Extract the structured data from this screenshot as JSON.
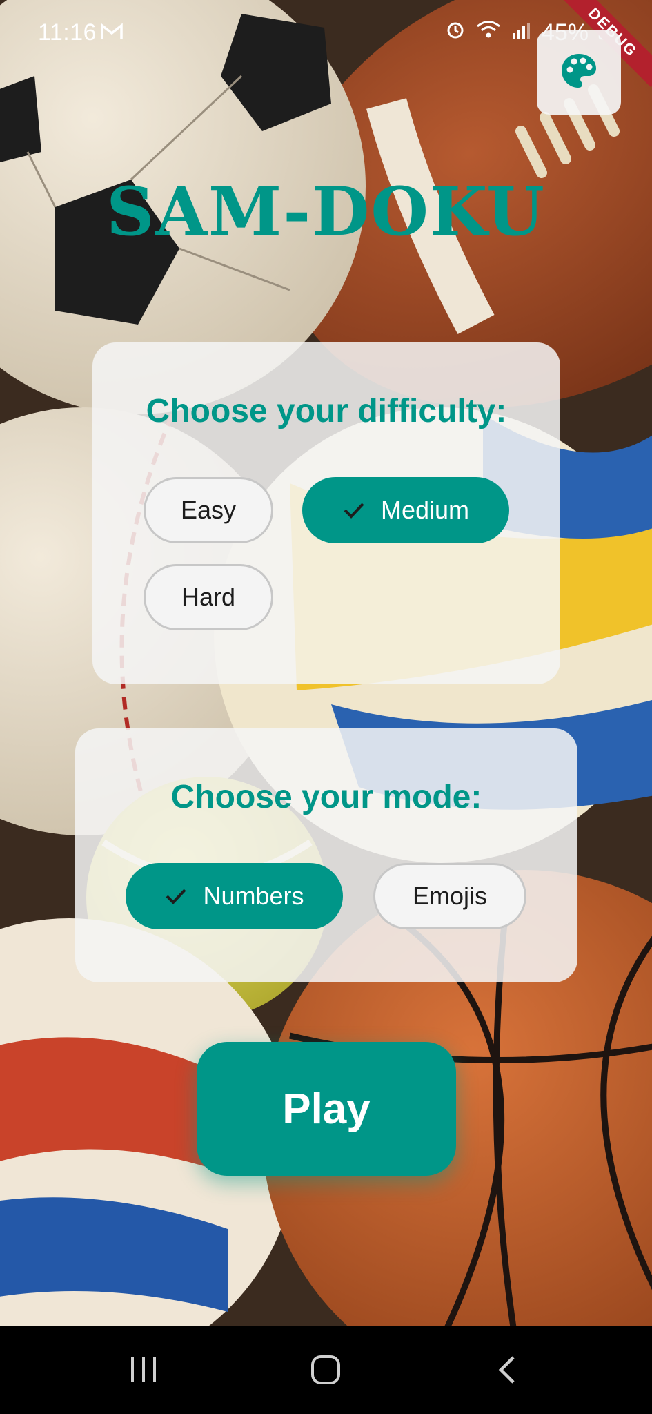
{
  "status": {
    "time": "11:16",
    "battery": "45%",
    "icons": [
      "gmail-icon",
      "alarm-icon",
      "wifi-icon",
      "signal-icon",
      "battery-icon"
    ]
  },
  "debug_banner": "DEBUG",
  "title": "SAM-DOKU",
  "difficulty": {
    "heading": "Choose your difficulty:",
    "options": [
      {
        "label": "Easy",
        "selected": false
      },
      {
        "label": "Medium",
        "selected": true
      },
      {
        "label": "Hard",
        "selected": false
      }
    ]
  },
  "mode": {
    "heading": "Choose your mode:",
    "options": [
      {
        "label": "Numbers",
        "selected": true
      },
      {
        "label": "Emojis",
        "selected": false
      }
    ]
  },
  "play_label": "Play",
  "colors": {
    "accent": "#009688",
    "card": "#f5f5f5",
    "debug": "#b3212d"
  },
  "nav": [
    "recents-icon",
    "home-icon",
    "back-icon"
  ]
}
